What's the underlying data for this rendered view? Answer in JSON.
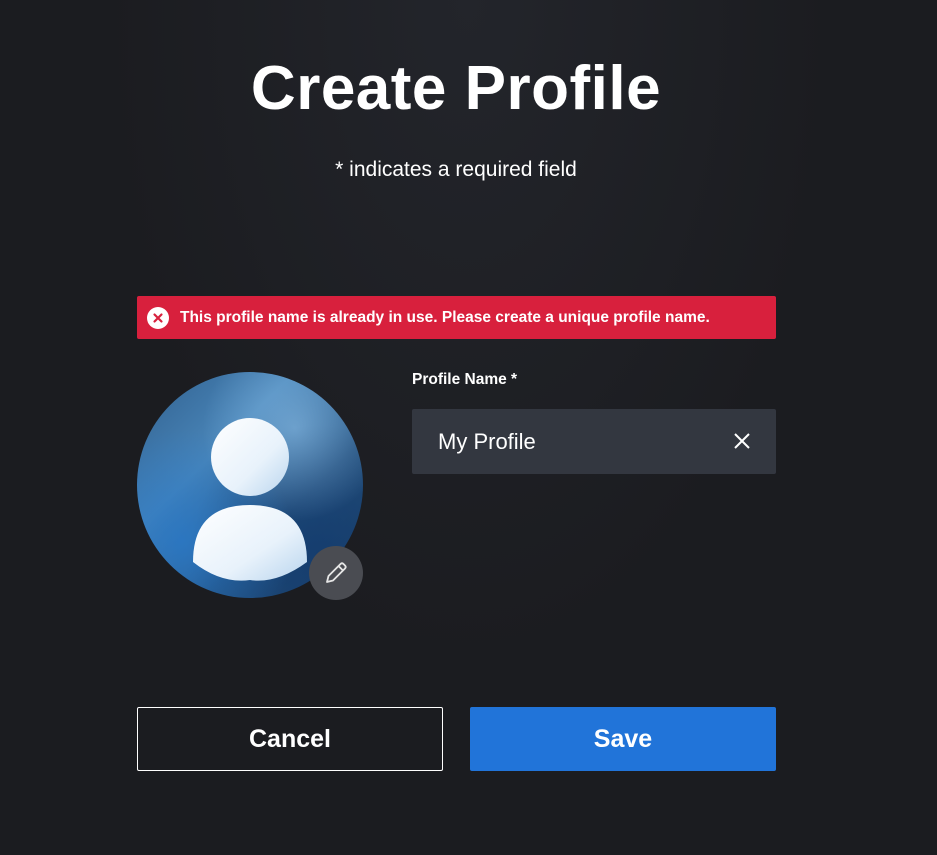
{
  "header": {
    "title": "Create Profile",
    "required_note": "* indicates a required field"
  },
  "error": {
    "message": "This profile name is already in use. Please create a unique profile name.",
    "icon": "error-x-icon",
    "color": "#d8203d"
  },
  "avatar": {
    "icon": "user-silhouette-icon",
    "edit_icon": "pencil-icon"
  },
  "profile_name": {
    "label": "Profile Name *",
    "value": "My Profile",
    "clear_icon": "close-icon"
  },
  "actions": {
    "cancel_label": "Cancel",
    "save_label": "Save",
    "save_color": "#2174d9"
  }
}
